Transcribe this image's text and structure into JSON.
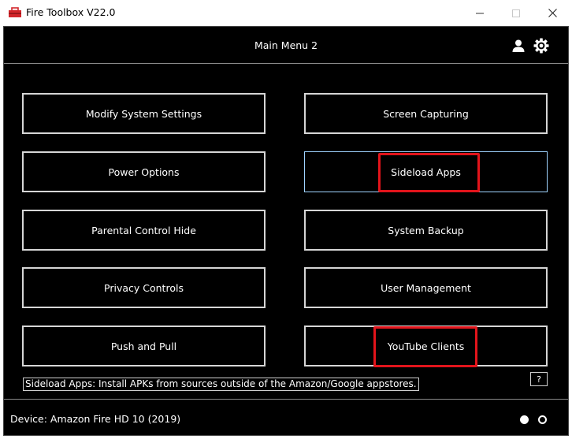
{
  "window": {
    "title": "Fire Toolbox V22.0",
    "icons": {
      "app": "toolbox-icon",
      "minimize": "minimize-icon",
      "maximize": "maximize-icon",
      "close": "close-icon"
    }
  },
  "header": {
    "title": "Main Menu 2",
    "icons": [
      "user-icon",
      "gear-icon"
    ]
  },
  "menu": {
    "left": [
      {
        "label": "Modify System Settings"
      },
      {
        "label": "Power Options"
      },
      {
        "label": "Parental Control Hide"
      },
      {
        "label": "Privacy Controls"
      },
      {
        "label": "Push and Pull"
      }
    ],
    "right": [
      {
        "label": "Screen Capturing"
      },
      {
        "label": "Sideload Apps",
        "state": "hovered",
        "highlighted": true
      },
      {
        "label": "System Backup"
      },
      {
        "label": "User Management"
      },
      {
        "label": "YouTube Clients",
        "highlighted": true
      }
    ]
  },
  "status": {
    "description": "Sideload Apps: Install APKs from sources outside of the Amazon/Google appstores.",
    "help_label": "?"
  },
  "footer": {
    "device": "Device: Amazon Fire HD 10 (2019)",
    "pages": {
      "current": 1,
      "total": 2
    }
  },
  "colors": {
    "background": "#000000",
    "button_border": "#d6d6d6",
    "hover_border": "#9fd3ff",
    "highlight": "#e2141b",
    "text": "#ffffff"
  }
}
